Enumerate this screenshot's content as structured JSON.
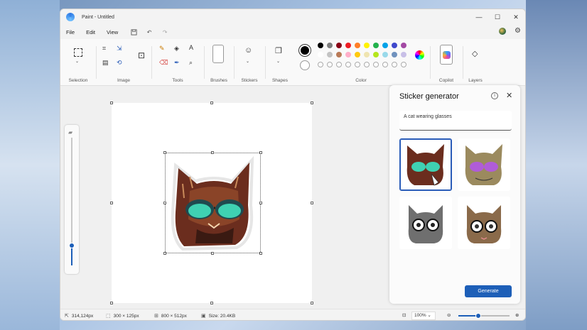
{
  "window": {
    "title": "Paint - Untitled"
  },
  "controls": {
    "minimize": "—",
    "maximize": "☐",
    "close": "✕"
  },
  "menu": {
    "file": "File",
    "edit": "Edit",
    "view": "View"
  },
  "ribbon": {
    "selection": "Selection",
    "image": "Image",
    "tools": "Tools",
    "brushes": "Brushes",
    "stickers": "Stickers",
    "shapes": "Shapes",
    "color": "Color",
    "copilot": "Copilot",
    "layers": "Layers"
  },
  "colors": {
    "primary": "#000000",
    "palette_row1": [
      "#000000",
      "#7f7f7f",
      "#880015",
      "#ed1c24",
      "#ff7f27",
      "#fff200",
      "#22b14c",
      "#00a2e8",
      "#3f48cc",
      "#a349a4"
    ],
    "palette_row2": [
      "#ffffff",
      "#c3c3c3",
      "#b97a57",
      "#ffaec9",
      "#ffc90e",
      "#efe4b0",
      "#b5e61d",
      "#99d9ea",
      "#7092be",
      "#c8bfe7"
    ]
  },
  "panel": {
    "title": "Sticker generator",
    "prompt": "A cat wearing glasses",
    "generate_label": "Generate"
  },
  "status": {
    "cursor_pos": "314,124px",
    "selection_size": "300 × 125px",
    "canvas_size": "800 × 512px",
    "file_size": "Size: 20.4KB",
    "zoom": "100%"
  }
}
